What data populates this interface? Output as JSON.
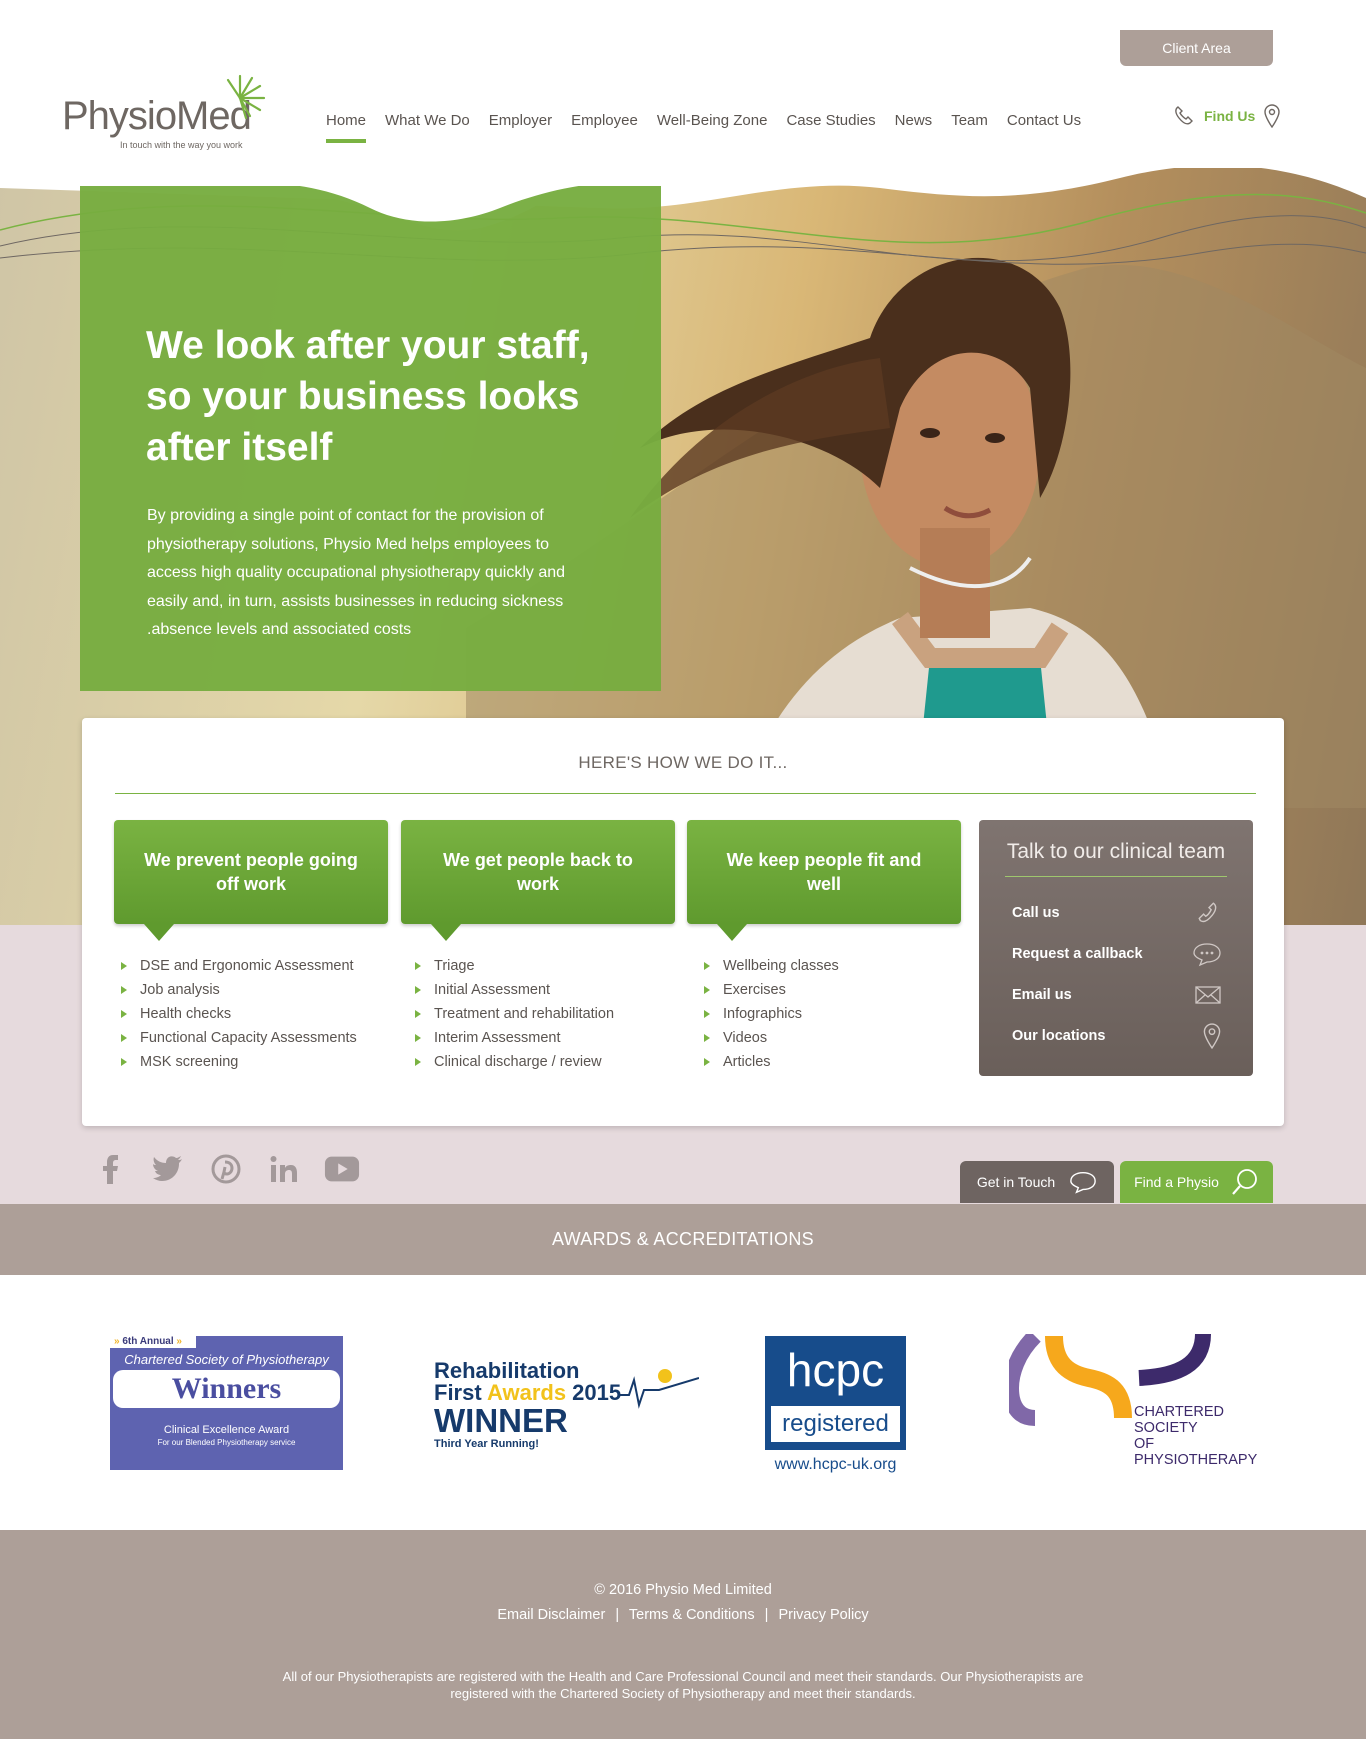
{
  "header": {
    "client_area": "Client Area",
    "logo": {
      "name": "PhysioMed",
      "tagline": "In touch with the way you work"
    },
    "nav": [
      "Home",
      "What We Do",
      "Employer",
      "Employee",
      "Well-Being Zone",
      "Case Studies",
      "News",
      "Team",
      "Contact Us"
    ],
    "active_nav": "Home",
    "find_us": "Find Us"
  },
  "hero": {
    "title_lines": [
      "We look after your staff,",
      "so your business looks",
      "after itself"
    ],
    "text_lines": [
      "By providing a single point of contact for the provision of",
      "physiotherapy solutions, Physio Med helps employees to",
      "access high quality occupational physiotherapy quickly and",
      "easily and, in turn, assists businesses in reducing sickness",
      ".absence levels and associated costs"
    ]
  },
  "how": {
    "title": "HERE'S HOW WE DO IT...",
    "columns": [
      {
        "heading": "We prevent people going off work",
        "items": [
          "DSE and Ergonomic Assessment",
          "Job analysis",
          "Health checks",
          "Functional Capacity Assessments",
          "MSK screening"
        ]
      },
      {
        "heading": "We get people back to work",
        "items": [
          "Triage",
          "Initial Assessment",
          "Treatment and rehabilitation",
          "Interim Assessment",
          "Clinical discharge / review"
        ]
      },
      {
        "heading": "We keep people fit and well",
        "items": [
          "Wellbeing classes",
          "Exercises",
          "Infographics",
          "Videos",
          "Articles"
        ]
      }
    ],
    "talk": {
      "title": "Talk to our clinical team",
      "rows": [
        "Call us",
        "Request a callback",
        "Email us",
        "Our locations"
      ]
    }
  },
  "actions": {
    "get_in_touch": "Get in Touch",
    "find_physio": "Find a Physio"
  },
  "social_icons": [
    "facebook-icon",
    "twitter-icon",
    "pinterest-icon",
    "linkedin-icon",
    "youtube-icon"
  ],
  "awards": {
    "title": "AWARDS & ACCREDITATIONS",
    "csp_winners": {
      "annual": "6th Annual",
      "org": "Chartered Society of Physiotherapy",
      "word": "Winners",
      "award": "Clinical Excellence Award",
      "detail": "For our Blended Physiotherapy service"
    },
    "rehab": {
      "line1": "Rehabilitation",
      "line2a": "First ",
      "line2b": "Awards",
      "line2c": " 2015",
      "winner": "WINNER",
      "running": "Third Year Running!"
    },
    "hcpc": {
      "top": "hcpc",
      "reg": "registered",
      "url": "www.hcpc-uk.org"
    },
    "csp": {
      "lines": [
        "CHARTERED",
        "SOCIETY",
        "OF",
        "PHYSIOTHERAPY"
      ]
    }
  },
  "footer": {
    "copyright": "© 2016 Physio Med Limited",
    "links": [
      "Email Disclaimer",
      "Terms & Conditions",
      "Privacy Policy"
    ],
    "separator": "|",
    "disclaimer_lines": [
      "All of our Physiotherapists are registered with the Health and Care Professional Council and meet their standards. Our Physiotherapists are",
      "registered with the Chartered Society of Physiotherapy and meet their standards."
    ]
  },
  "colors": {
    "green": "#7ab342",
    "taupe": "#ad9f98",
    "dark_taupe": "#6e6461",
    "band": "#e6dadd"
  }
}
